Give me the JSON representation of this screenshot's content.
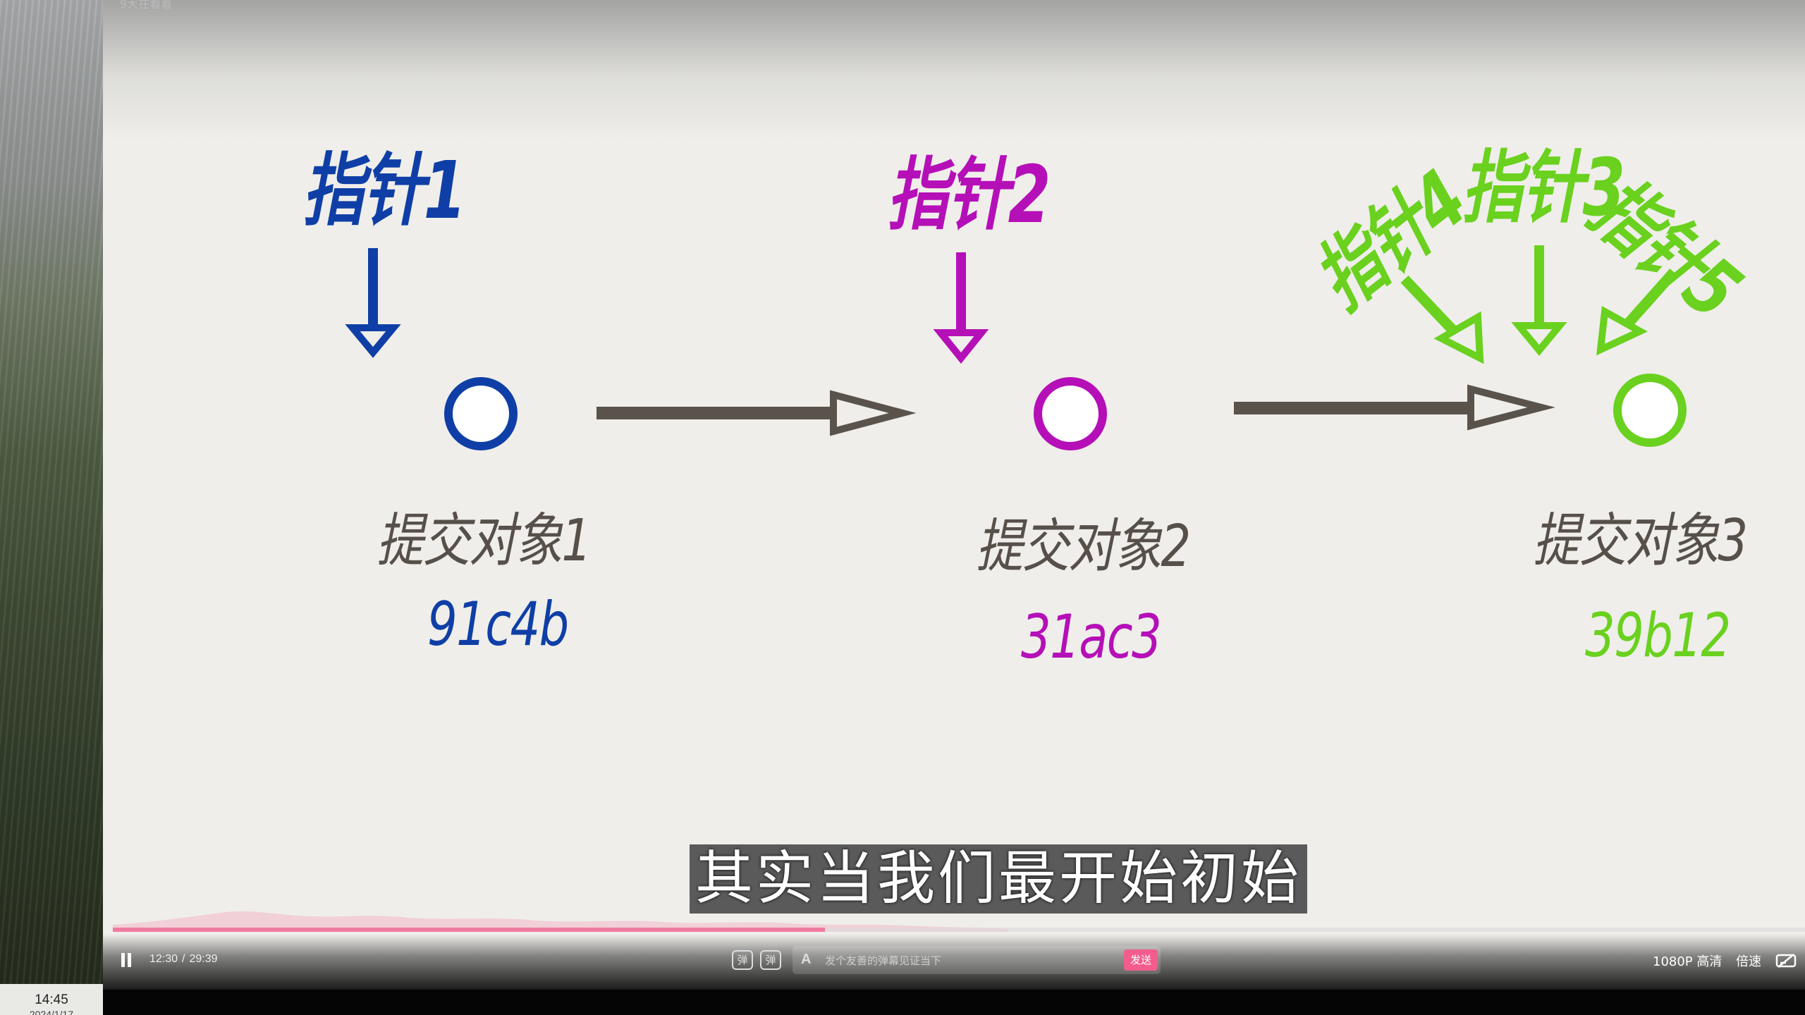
{
  "taskbar": {
    "time": "14:45",
    "date": "2024/1/17"
  },
  "player": {
    "video_title": "9大在看着",
    "subtitle": "其实当我们最开始初始",
    "current_time": "12:30",
    "time_separator": "/",
    "duration": "29:39",
    "progress": 0.421,
    "danmaku_toggle_icon": "弹",
    "danmaku_settings_icon": "弹",
    "danmaku_placeholder": "发个友善的弹幕见证当下",
    "send_label": "发送",
    "quality_label": "1080P 高清",
    "speed_label": "倍速",
    "accent_color": "#f25d8e"
  },
  "diagram": {
    "pointers": {
      "p1": "指针1",
      "p2": "指针2",
      "p3": "指针3",
      "p4": "指针4",
      "p5": "指针5"
    },
    "commits": [
      {
        "name": "提交对象1",
        "hash": "91c4b",
        "color": "#0f3fa6"
      },
      {
        "name": "提交对象2",
        "hash": "31ac3",
        "color": "#b50fb8"
      },
      {
        "name": "提交对象3",
        "hash": "39b12",
        "color": "#6ad11f"
      }
    ],
    "arrow_color": "#5a534c"
  }
}
